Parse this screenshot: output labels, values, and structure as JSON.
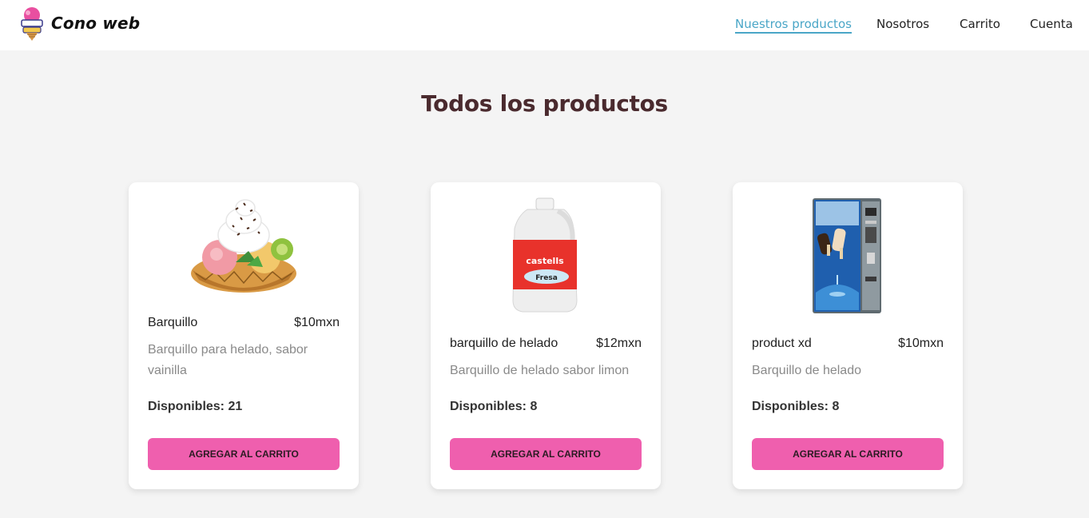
{
  "brand": {
    "name": "Cono web",
    "logo_icon": "ice-cream-logo-icon"
  },
  "nav": {
    "links": [
      {
        "label": "Nuestros productos",
        "active": true
      },
      {
        "label": "Nosotros",
        "active": false
      },
      {
        "label": "Carrito",
        "active": false
      },
      {
        "label": "Cuenta",
        "active": false
      }
    ]
  },
  "page": {
    "title": "Todos los productos"
  },
  "colors": {
    "accent": "#4aa6c7",
    "button": "#ef5fae",
    "title": "#4a2a2e",
    "background": "#f4f4f4"
  },
  "products": [
    {
      "name": "Barquillo",
      "price": "$10mxn",
      "description": "Barquillo para helado, sabor vainilla",
      "stock": "Disponibles: 21",
      "button": "AGREGAR AL CARRITO",
      "image_icon": "ice-cream-bowl-image"
    },
    {
      "name": "barquillo de helado",
      "price": "$12mxn",
      "description": "Barquillo de helado sabor limon",
      "stock": "Disponibles: 8",
      "button": "AGREGAR AL CARRITO",
      "image_icon": "syrup-jug-image"
    },
    {
      "name": "product xd",
      "price": "$10mxn",
      "description": "Barquillo de helado",
      "stock": "Disponibles: 8",
      "button": "AGREGAR AL CARRITO",
      "image_icon": "vending-machine-image"
    }
  ],
  "image_text": {
    "jug_brand": "castells",
    "jug_flavor": "Fresa"
  }
}
